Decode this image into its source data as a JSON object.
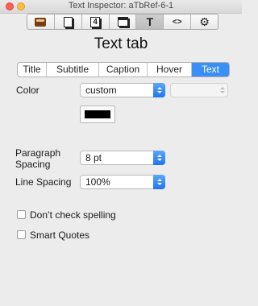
{
  "window": {
    "title": "Text Inspector: aTbRef-6-1"
  },
  "toolbar": {
    "buttons": [
      {
        "name": "inspector-icon"
      },
      {
        "name": "document-icon"
      },
      {
        "name": "number-icon",
        "glyph": "4"
      },
      {
        "name": "frame-icon"
      },
      {
        "name": "text-icon",
        "glyph": "T",
        "active": true
      },
      {
        "name": "code-icon",
        "glyph": "<>"
      },
      {
        "name": "gear-icon",
        "glyph": "⚙"
      }
    ]
  },
  "heading": "Text tab",
  "tabs": [
    "Title",
    "Subtitle",
    "Caption",
    "Hover",
    "Text"
  ],
  "active_tab": "Text",
  "color": {
    "label": "Color",
    "value": "custom",
    "swatch_color": "#000000"
  },
  "paragraph_spacing": {
    "label": "Paragraph Spacing",
    "value": "8 pt"
  },
  "line_spacing": {
    "label": "Line Spacing",
    "value": "100%"
  },
  "options": {
    "dont_check_spelling": {
      "label": "Don’t check spelling",
      "checked": false
    },
    "smart_quotes": {
      "label": "Smart Quotes",
      "checked": false
    }
  },
  "colors": {
    "accent": "#3a8ff7"
  }
}
